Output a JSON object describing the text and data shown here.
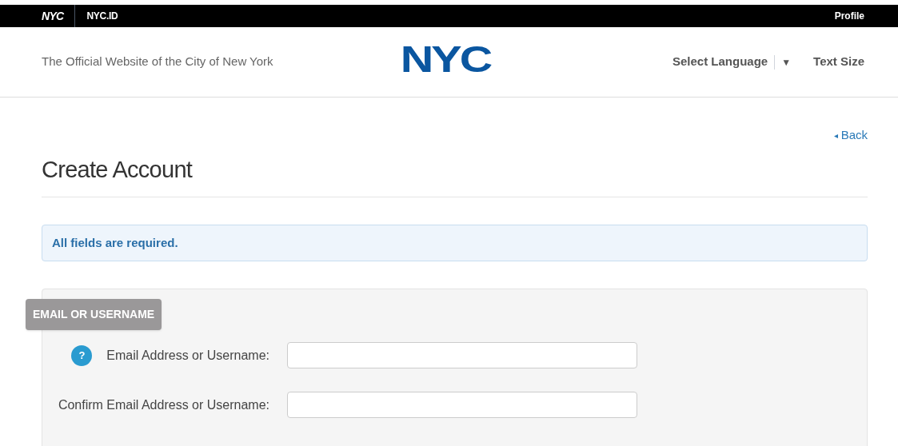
{
  "top_bar": {
    "logo": "NYC",
    "site": "NYC.ID",
    "profile": "Profile"
  },
  "header": {
    "tagline": "The Official Website of the City of New York",
    "logo": "NYC",
    "language": "Select Language",
    "language_caret": "▼",
    "text_size": "Text Size"
  },
  "back_link": {
    "arrow": "◂",
    "label": "Back"
  },
  "title": "Create Account",
  "notice": "All fields are required.",
  "section": {
    "badge": "EMAIL OR USERNAME",
    "fields": [
      {
        "label": "Email Address or Username:",
        "help": "?"
      },
      {
        "label": "Confirm Email Address or Username:"
      }
    ]
  }
}
